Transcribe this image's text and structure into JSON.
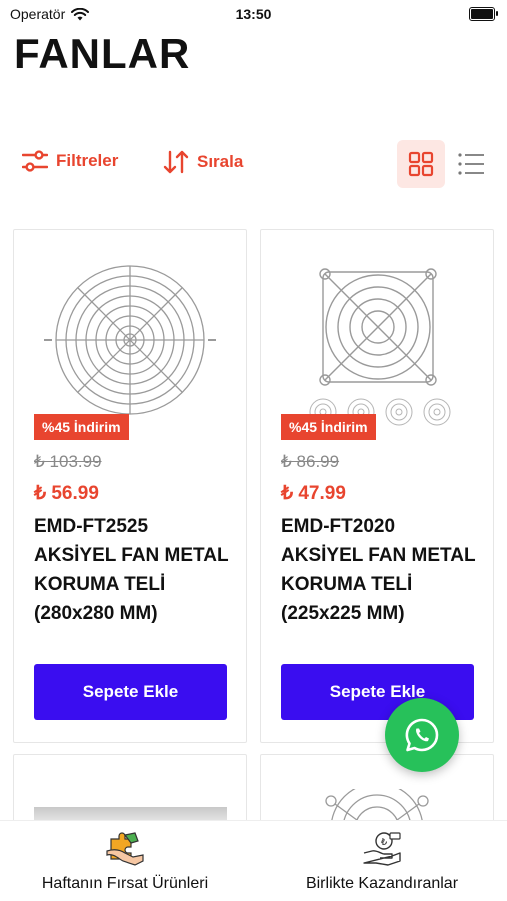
{
  "status_bar": {
    "carrier": "Operatör",
    "time": "13:50"
  },
  "page": {
    "title": "FANLAR"
  },
  "toolbar": {
    "filters_label": "Filtreler",
    "sort_label": "Sırala",
    "active_view": "grid"
  },
  "products": [
    {
      "badge": "%45 İndirim",
      "old_price": "₺ 103.99",
      "price": "₺ 56.99",
      "name": "EMD-FT2525 AKSİYEL FAN METAL KORUMA TELİ (280x280 MM)",
      "button": "Sepete Ekle"
    },
    {
      "badge": "%45 İndirim",
      "old_price": "₺ 86.99",
      "price": "₺ 47.99",
      "name": "EMD-FT2020 AKSİYEL FAN METAL KORUMA TELİ (225x225 MM)",
      "button": "Sepete Ekle"
    }
  ],
  "tabbar": {
    "items": [
      {
        "label": "Haftanın Fırsat Ürünleri",
        "icon": "puzzle-hand-icon"
      },
      {
        "label": "Birlikte Kazandıranlar",
        "icon": "money-hand-icon"
      }
    ]
  },
  "colors": {
    "accent": "#e8452f",
    "button": "#3a0df0",
    "whatsapp": "#27c15a"
  }
}
